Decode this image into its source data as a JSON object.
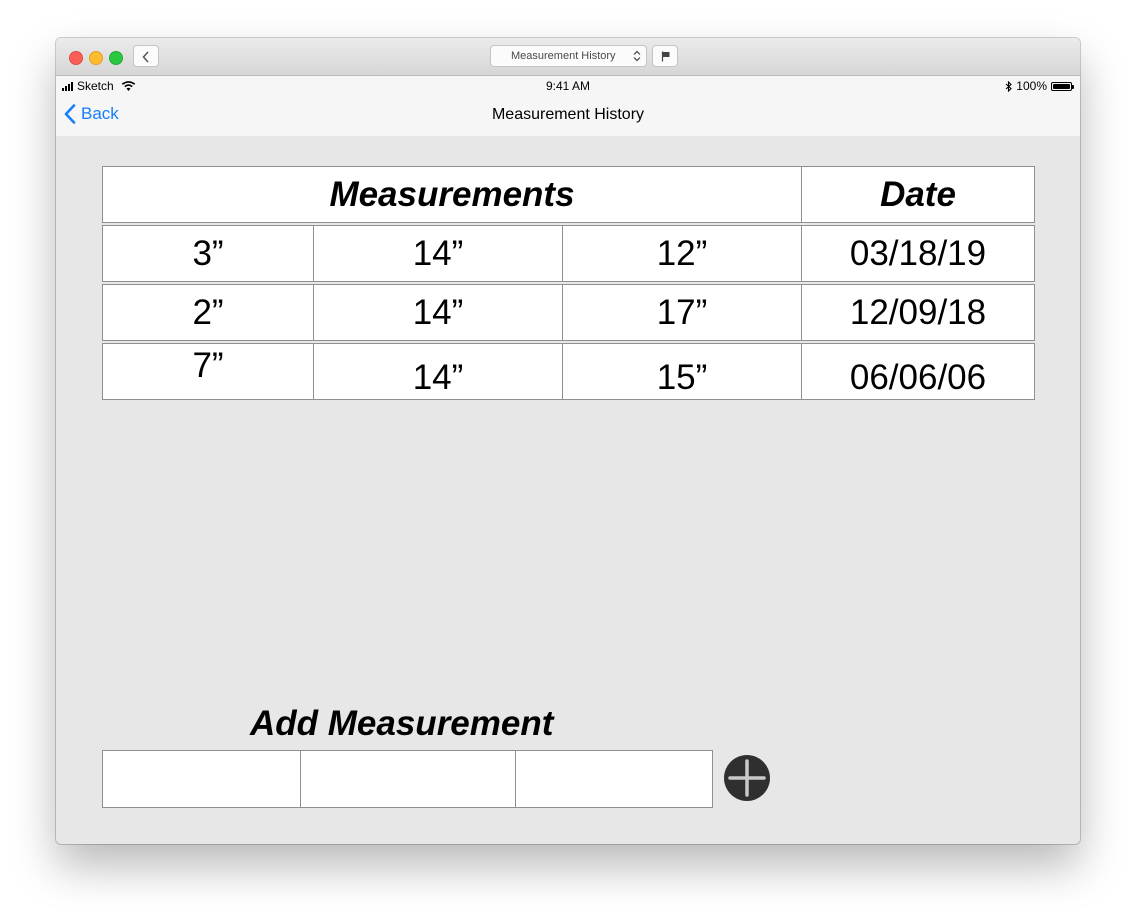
{
  "window": {
    "title_select": "Measurement History"
  },
  "status_bar": {
    "carrier": "Sketch",
    "time": "9:41 AM",
    "battery": "100%",
    "battery_level": 1.0
  },
  "nav": {
    "back_label": "Back",
    "title": "Measurement History"
  },
  "table": {
    "headers": {
      "measurements": "Measurements",
      "date": "Date"
    },
    "rows": [
      {
        "m1": "3”",
        "m2": "14”",
        "m3": "12”",
        "date": "03/18/19"
      },
      {
        "m1": "2”",
        "m2": "14”",
        "m3": "17”",
        "date": "12/09/18"
      },
      {
        "m1": "7”",
        "m2": "14”",
        "m3": "15”",
        "date": "06/06/06"
      }
    ]
  },
  "add": {
    "title": "Add Measurement",
    "inputs": [
      {
        "value": "",
        "placeholder": ""
      },
      {
        "value": "",
        "placeholder": ""
      },
      {
        "value": "",
        "placeholder": ""
      }
    ],
    "button_icon": "plus-circle-icon"
  },
  "colors": {
    "accent": "#157efb",
    "background": "#e7e7e7",
    "add_button": "#2f2f2f"
  }
}
